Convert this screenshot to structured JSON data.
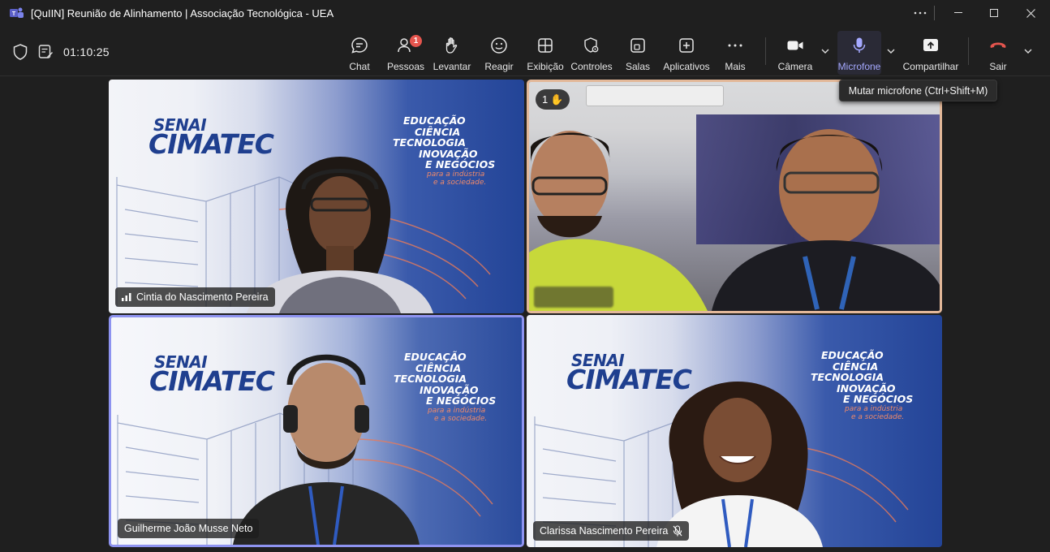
{
  "window": {
    "title": "[QuIIN] Reunião de Alinhamento | Associação Tecnológica - UEA",
    "more_icon": "ellipsis-icon",
    "controls": [
      "minimize-icon",
      "maximize-icon",
      "close-icon"
    ]
  },
  "meeting": {
    "timer": "01:10:25"
  },
  "toolbar": {
    "chat": "Chat",
    "people": "Pessoas",
    "people_badge": "1",
    "raise": "Levantar",
    "react": "Reagir",
    "view": "Exibição",
    "controls": "Controles",
    "rooms": "Salas",
    "apps": "Aplicativos",
    "more": "Mais",
    "camera": "Câmera",
    "mic": "Microfone",
    "share": "Compartilhar",
    "leave": "Sair"
  },
  "tooltip": {
    "text": "Mutar microfone (Ctrl+Shift+M)"
  },
  "banner": {
    "senai": "SENAI",
    "cimatec": "CIMATEC",
    "line1": "EDUCAÇÃO",
    "line2": "CIÊNCIA",
    "line3": "TECNOLOGIA",
    "line4": "INOVAÇÃO",
    "line5": "E NEGÓCIOS",
    "sub1": "para a indústria",
    "sub2": "e a sociedade."
  },
  "participants": [
    {
      "name": "Cintia do Nascimento Pereira",
      "status_icon": "signal-bars-icon"
    },
    {
      "name": "",
      "hand_count": "1",
      "hand_icon": "raised-hand-icon"
    },
    {
      "name": "Guilherme João Musse Neto"
    },
    {
      "name": "Clarissa Nascimento Pereira",
      "status_icon": "mic-muted-icon"
    }
  ],
  "colors": {
    "accent": "#a5a9ff",
    "leave_red": "#e5554e",
    "active_speaker_border": "#8e93f0",
    "hand_raised_border": "#e3b899"
  }
}
